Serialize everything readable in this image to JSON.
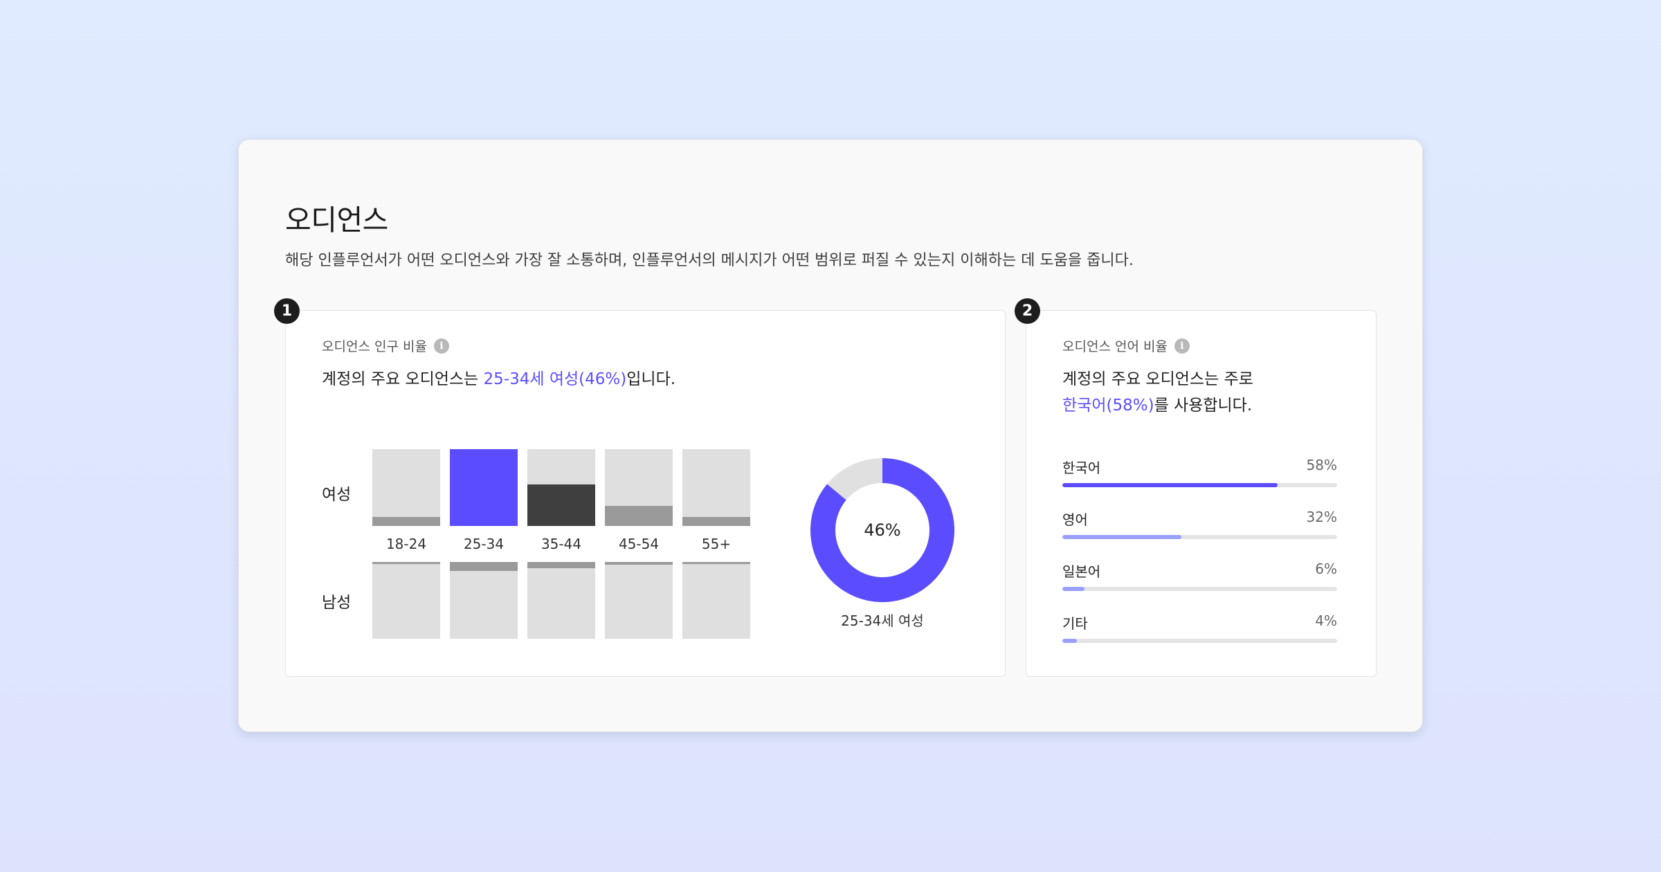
{
  "section": {
    "title": "오디언스",
    "subtitle": "해당 인플루언서가 어떤 오디언스와 가장 잘 소통하며, 인플루언서의 메시지가 어떤 범위로 퍼질 수 있는지 이해하는 데 도움을 줍니다."
  },
  "demographics": {
    "badge": "1",
    "label": "오디언스 인구 비율",
    "info_icon": "info-icon",
    "headline_prefix": "계정의 주요 오디언스는 ",
    "headline_highlight": "25-34세 여성(46%)",
    "headline_suffix": "입니다.",
    "female_label": "여성",
    "male_label": "남성",
    "donut_value": "46%",
    "donut_caption": "25-34세 여성",
    "colors": {
      "accent": "#5b4dff",
      "dark": "#3f3f3f",
      "gray": "#9a9a9a",
      "empty": "#dfdfdf"
    }
  },
  "chart_data": {
    "type": "bar",
    "categories": [
      "18-24",
      "25-34",
      "35-44",
      "45-54",
      "55+"
    ],
    "series": [
      {
        "name": "여성",
        "values": [
          0.12,
          1.0,
          0.54,
          0.26,
          0.12
        ],
        "colors": [
          "#9a9a9a",
          "#5b4dff",
          "#3f3f3f",
          "#9a9a9a",
          "#9a9a9a"
        ]
      },
      {
        "name": "남성",
        "values": [
          0.03,
          0.12,
          0.08,
          0.04,
          0.03
        ],
        "colors": [
          "#9a9a9a",
          "#9a9a9a",
          "#9a9a9a",
          "#9a9a9a",
          "#9a9a9a"
        ]
      }
    ],
    "donut": {
      "value": 46
    }
  },
  "languages": {
    "badge": "2",
    "label": "오디언스 언어 비율",
    "headline_line1": "계정의 주요 오디언스는 주로",
    "headline_highlight": "한국어(58%)",
    "headline_suffix": "를 사용합니다.",
    "items": [
      {
        "name": "한국어",
        "pct": "58%",
        "value": 58,
        "color": "#5b4dff"
      },
      {
        "name": "영어",
        "pct": "32%",
        "value": 32,
        "color": "#9aa0ff"
      },
      {
        "name": "일본어",
        "pct": "6%",
        "value": 6,
        "color": "#9aa0ff"
      },
      {
        "name": "기타",
        "pct": "4%",
        "value": 4,
        "color": "#9aa0ff"
      }
    ]
  }
}
